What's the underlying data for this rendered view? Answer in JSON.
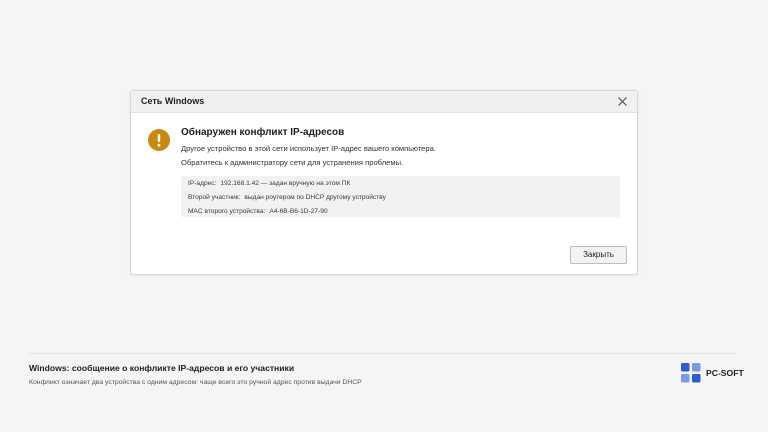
{
  "dialog": {
    "title": "Сеть Windows",
    "headline": "Обнаружен конфликт IP-адресов",
    "message_line1": "Другое устройство в этой сети использует IP-адрес вашего компьютера.",
    "message_line2": "Обратитесь к администратору сети для устранения проблемы.",
    "details": [
      {
        "label": "IP-адрес:",
        "value": "192.168.1.42 — задан вручную на этом ПК"
      },
      {
        "label": "Второй участник:",
        "value": "выдан роутером по DHCP другому устройству"
      },
      {
        "label": "MAC второго устройства:",
        "value": "A4-6B-B6-1D-27-90"
      }
    ],
    "close_button_label": "Закрыть",
    "warning_icon": "warning-icon",
    "warning_color": "#c98a0b"
  },
  "footer": {
    "title": "Windows: сообщение о конфликте IP-адресов и его участники",
    "subtitle": "Конфликт означает два устройства с одним адресом: чаще всего это ручной адрес против выдачи DHCP",
    "logo_text": "PC-SOFT",
    "logo_colors": [
      "#2d5fd3",
      "#7a9ae6"
    ]
  }
}
